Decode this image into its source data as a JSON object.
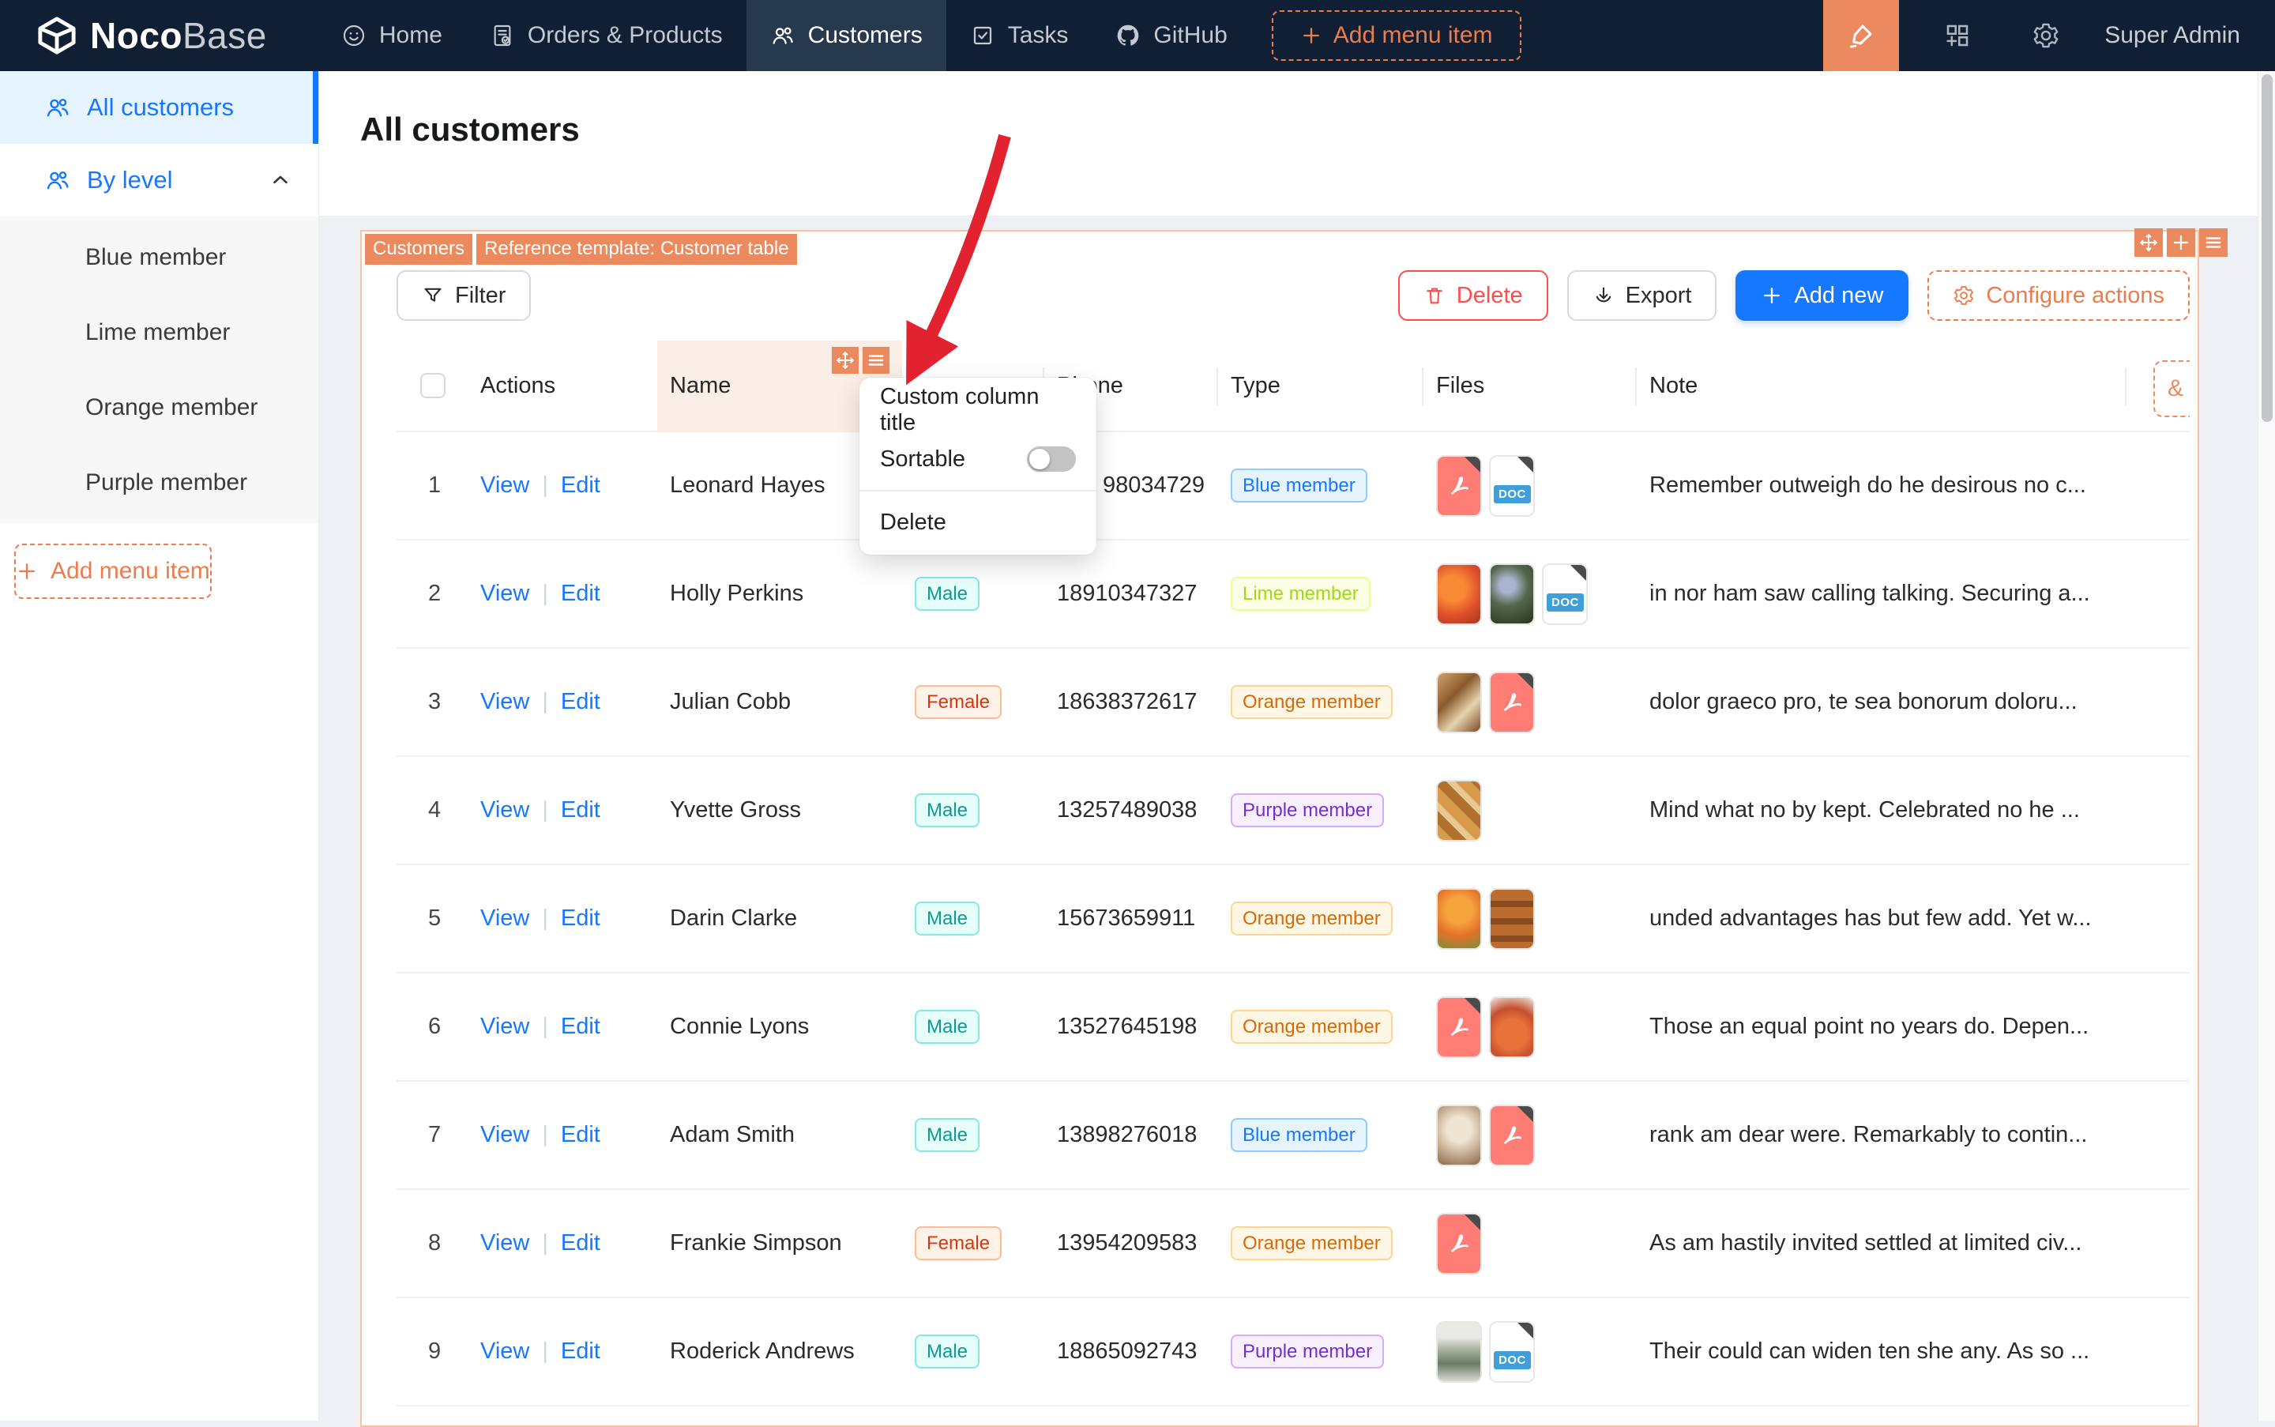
{
  "navbar": {
    "logo": {
      "part1": "Noco",
      "part2": "Base"
    },
    "items": [
      {
        "label": "Home",
        "icon": "home-icon",
        "active": false
      },
      {
        "label": "Orders & Products",
        "icon": "orders-icon",
        "active": false
      },
      {
        "label": "Customers",
        "icon": "customers-icon",
        "active": true
      },
      {
        "label": "Tasks",
        "icon": "tasks-icon",
        "active": false
      },
      {
        "label": "GitHub",
        "icon": "github-icon",
        "active": false
      }
    ],
    "add_menu_item_label": "Add menu item",
    "user": "Super Admin"
  },
  "sidebar": {
    "all_customers_label": "All customers",
    "by_level_label": "By level",
    "sub_items": [
      {
        "label": "Blue member"
      },
      {
        "label": "Lime member"
      },
      {
        "label": "Orange member"
      },
      {
        "label": "Purple member"
      }
    ],
    "add_menu_item_label": "Add menu item"
  },
  "page": {
    "title": "All customers"
  },
  "card": {
    "tags": {
      "collection": "Customers",
      "template": "Reference template: Customer table"
    },
    "toolbar": {
      "filter": "Filter",
      "delete": "Delete",
      "export": "Export",
      "add_new": "Add new",
      "configure_actions": "Configure actions"
    },
    "clipped_button_label": "&"
  },
  "table": {
    "headers": {
      "select": "",
      "actions": "Actions",
      "name": "Name",
      "gender": "",
      "phone": "Phone",
      "type": "Type",
      "files": "Files",
      "note": "Note"
    },
    "action_labels": {
      "view": "View",
      "edit": "Edit",
      "separator": "|"
    },
    "rows": [
      {
        "index": "1",
        "name": "Leonard Hayes",
        "gender": null,
        "phone": "98034729",
        "phone_clipped": true,
        "type": {
          "label": "Blue member",
          "color": "blue"
        },
        "files": [
          {
            "kind": "pdf"
          },
          {
            "kind": "doc"
          }
        ],
        "note": "Remember outweigh do he desirous no c..."
      },
      {
        "index": "2",
        "name": "Holly Perkins",
        "gender": {
          "label": "Male",
          "color": "cyan"
        },
        "phone": "18910347327",
        "type": {
          "label": "Lime member",
          "color": "lime"
        },
        "files": [
          {
            "kind": "img",
            "variant": "orange-fruit"
          },
          {
            "kind": "img",
            "variant": "flowers"
          },
          {
            "kind": "doc"
          }
        ],
        "note": "in nor ham saw calling talking. Securing a..."
      },
      {
        "index": "3",
        "name": "Julian Cobb",
        "gender": {
          "label": "Female",
          "color": "volcano"
        },
        "phone": "18638372617",
        "type": {
          "label": "Orange member",
          "color": "orange"
        },
        "files": [
          {
            "kind": "img",
            "variant": "food"
          },
          {
            "kind": "pdf"
          }
        ],
        "note": "dolor graeco pro, te sea bonorum doloru..."
      },
      {
        "index": "4",
        "name": "Yvette Gross",
        "gender": {
          "label": "Male",
          "color": "cyan"
        },
        "phone": "13257489038",
        "type": {
          "label": "Purple member",
          "color": "purple"
        },
        "files": [
          {
            "kind": "img",
            "variant": "bread"
          }
        ],
        "note": "Mind what no by kept. Celebrated no he ..."
      },
      {
        "index": "5",
        "name": "Darin Clarke",
        "gender": {
          "label": "Male",
          "color": "cyan"
        },
        "phone": "15673659911",
        "type": {
          "label": "Orange member",
          "color": "orange"
        },
        "files": [
          {
            "kind": "img",
            "variant": "oranges"
          },
          {
            "kind": "img",
            "variant": "trays"
          }
        ],
        "note": "unded advantages has but few add. Yet w..."
      },
      {
        "index": "6",
        "name": "Connie Lyons",
        "gender": {
          "label": "Male",
          "color": "cyan"
        },
        "phone": "13527645198",
        "type": {
          "label": "Orange member",
          "color": "orange"
        },
        "files": [
          {
            "kind": "pdf"
          },
          {
            "kind": "img",
            "variant": "onions"
          }
        ],
        "note": "Those an equal point no years do. Depen..."
      },
      {
        "index": "7",
        "name": "Adam Smith",
        "gender": {
          "label": "Male",
          "color": "cyan"
        },
        "phone": "13898276018",
        "type": {
          "label": "Blue member",
          "color": "blue"
        },
        "files": [
          {
            "kind": "img",
            "variant": "coffee"
          },
          {
            "kind": "pdf"
          }
        ],
        "note": "rank am dear were. Remarkably to contin..."
      },
      {
        "index": "8",
        "name": "Frankie Simpson",
        "gender": {
          "label": "Female",
          "color": "volcano"
        },
        "phone": "13954209583",
        "type": {
          "label": "Orange member",
          "color": "orange"
        },
        "files": [
          {
            "kind": "pdf"
          }
        ],
        "note": "As am hastily invited settled at limited civ..."
      },
      {
        "index": "9",
        "name": "Roderick Andrews",
        "gender": {
          "label": "Male",
          "color": "cyan"
        },
        "phone": "18865092743",
        "type": {
          "label": "Purple member",
          "color": "purple"
        },
        "files": [
          {
            "kind": "img",
            "variant": "shelf"
          },
          {
            "kind": "doc"
          }
        ],
        "note": "Their could can widen ten she any. As so ..."
      }
    ]
  },
  "files_meta": {
    "doc_badge": "DOC"
  },
  "dropdown": {
    "custom_title": "Custom column title",
    "sortable": "Sortable",
    "sortable_on": false,
    "delete": "Delete"
  },
  "colors": {
    "navbar_bg": "#101f33",
    "accent_orange": "#ec8a5f",
    "accent_orange_border": "#ed7c4c",
    "primary_blue": "#1677ff",
    "danger_red": "#ff4d4f",
    "arrow_red": "#e32230"
  }
}
